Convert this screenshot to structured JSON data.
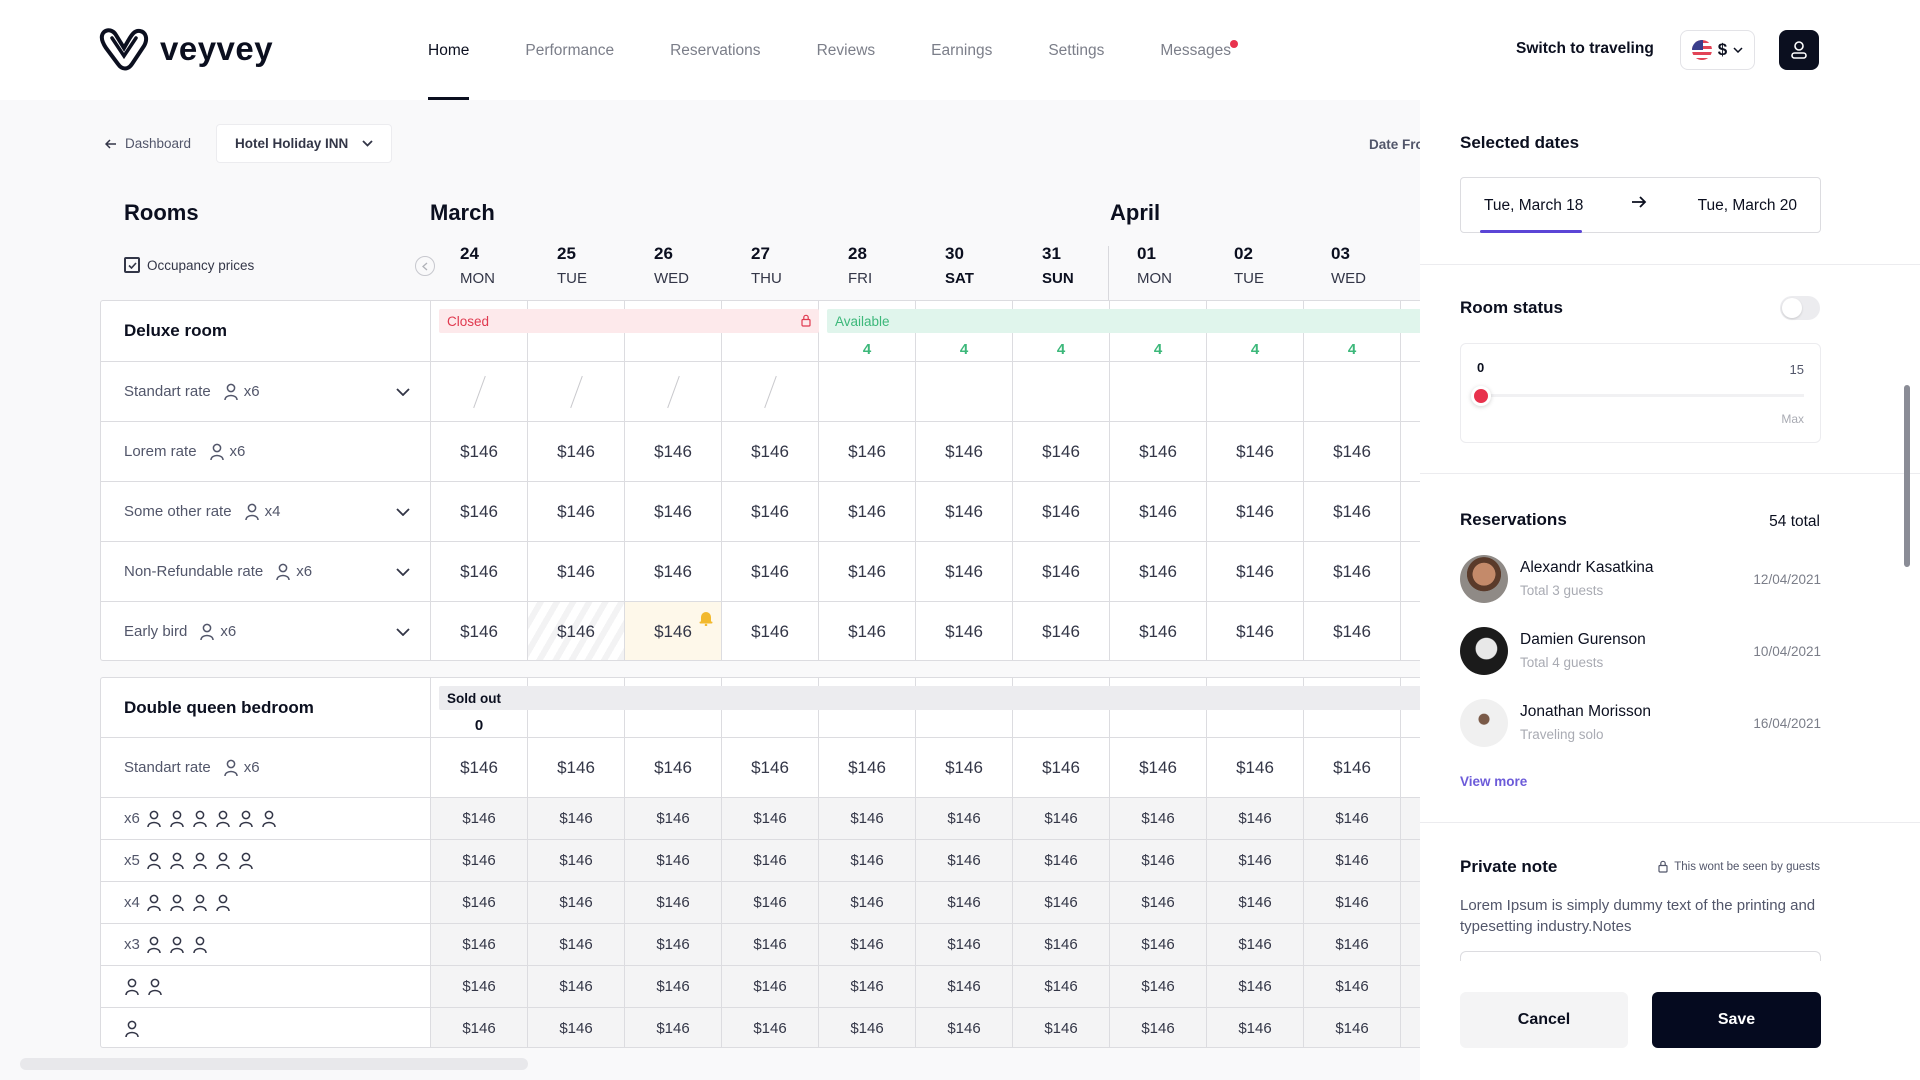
{
  "header": {
    "brand": "veyvey",
    "nav": [
      {
        "label": "Home",
        "active": true
      },
      {
        "label": "Performance",
        "active": false
      },
      {
        "label": "Reservations",
        "active": false
      },
      {
        "label": "Reviews",
        "active": false
      },
      {
        "label": "Earnings",
        "active": false
      },
      {
        "label": "Settings",
        "active": false
      },
      {
        "label": "Messages",
        "active": false,
        "notification": true
      }
    ],
    "switch_label": "Switch to traveling",
    "currency": "$",
    "flag_icon": "us-flag-icon",
    "profile_icon": "user-icon"
  },
  "subbar": {
    "back_label": "Dashboard",
    "hotel": "Hotel Holiday INN",
    "date_from_label": "Date From"
  },
  "calendar": {
    "rooms_title": "Rooms",
    "occupancy_label": "Occupancy prices",
    "occupancy_checked": true,
    "months": [
      "March",
      "April"
    ],
    "days": [
      {
        "num": "24",
        "dow": "MON",
        "weekend": false
      },
      {
        "num": "25",
        "dow": "TUE",
        "weekend": false
      },
      {
        "num": "26",
        "dow": "WED",
        "weekend": false
      },
      {
        "num": "27",
        "dow": "THU",
        "weekend": false
      },
      {
        "num": "28",
        "dow": "FRI",
        "weekend": false
      },
      {
        "num": "30",
        "dow": "SAT",
        "weekend": true
      },
      {
        "num": "31",
        "dow": "SUN",
        "weekend": true
      },
      {
        "num": "01",
        "dow": "MON",
        "weekend": false
      },
      {
        "num": "02",
        "dow": "TUE",
        "weekend": false
      },
      {
        "num": "03",
        "dow": "WED",
        "weekend": false
      }
    ]
  },
  "rooms": [
    {
      "name": "Deluxe room",
      "status_closed": "Closed",
      "status_available": "Available",
      "availability": [
        "",
        "",
        "",
        "",
        "4",
        "4",
        "4",
        "4",
        "4",
        "4"
      ],
      "rates": [
        {
          "name": "Standart rate",
          "persons": "x6",
          "expandable": true,
          "prices": [
            "/",
            "/",
            "/",
            "/",
            "",
            "",
            "",
            "",
            "",
            ""
          ]
        },
        {
          "name": "Lorem rate",
          "persons": "x6",
          "expandable": false,
          "prices": [
            "$146",
            "$146",
            "$146",
            "$146",
            "$146",
            "$146",
            "$146",
            "$146",
            "$146",
            "$146"
          ]
        },
        {
          "name": "Some other rate",
          "persons": "x4",
          "expandable": true,
          "prices": [
            "$146",
            "$146",
            "$146",
            "$146",
            "$146",
            "$146",
            "$146",
            "$146",
            "$146",
            "$146"
          ]
        },
        {
          "name": "Non-Refundable rate",
          "persons": "x6",
          "expandable": true,
          "prices": [
            "$146",
            "$146",
            "$146",
            "$146",
            "$146",
            "$146",
            "$146",
            "$146",
            "$146",
            "$146"
          ]
        },
        {
          "name": "Early bird",
          "persons": "x6",
          "expandable": true,
          "prices": [
            "$146",
            "$146",
            "$146",
            "$146",
            "$146",
            "$146",
            "$146",
            "$146",
            "$146",
            "$146"
          ]
        }
      ]
    },
    {
      "name": "Double queen bedroom",
      "status_sold": "Sold out",
      "availability": [
        "0"
      ],
      "rates": [
        {
          "name": "Standart rate",
          "persons": "x6",
          "prices": [
            "$146",
            "$146",
            "$146",
            "$146",
            "$146",
            "$146",
            "$146",
            "$146",
            "$146",
            "$146"
          ]
        }
      ],
      "occupancy": [
        {
          "label": "x6",
          "count": 6,
          "prices": [
            "$146",
            "$146",
            "$146",
            "$146",
            "$146",
            "$146",
            "$146",
            "$146",
            "$146",
            "$146"
          ]
        },
        {
          "label": "x5",
          "count": 5,
          "prices": [
            "$146",
            "$146",
            "$146",
            "$146",
            "$146",
            "$146",
            "$146",
            "$146",
            "$146",
            "$146"
          ]
        },
        {
          "label": "x4",
          "count": 4,
          "prices": [
            "$146",
            "$146",
            "$146",
            "$146",
            "$146",
            "$146",
            "$146",
            "$146",
            "$146",
            "$146"
          ]
        },
        {
          "label": "x3",
          "count": 3,
          "prices": [
            "$146",
            "$146",
            "$146",
            "$146",
            "$146",
            "$146",
            "$146",
            "$146",
            "$146",
            "$146"
          ]
        },
        {
          "label": "",
          "count": 2,
          "prices": [
            "$146",
            "$146",
            "$146",
            "$146",
            "$146",
            "$146",
            "$146",
            "$146",
            "$146",
            "$146"
          ]
        },
        {
          "label": "",
          "count": 1,
          "prices": [
            "$146",
            "$146",
            "$146",
            "$146",
            "$146",
            "$146",
            "$146",
            "$146",
            "$146",
            "$146"
          ]
        }
      ]
    }
  ],
  "panel": {
    "selected_dates_title": "Selected dates",
    "date_start": "Tue, March 18",
    "date_end": "Tue, March 20",
    "room_status_title": "Room status",
    "room_status_on": false,
    "slider": {
      "min": "0",
      "max": "15",
      "max_label": "Max",
      "value": 0
    },
    "reservations_title": "Reservations",
    "reservations_total": "54 total",
    "reservations": [
      {
        "name": "Alexandr Kasatkina",
        "sub": "Total 3 guests",
        "date": "12/04/2021"
      },
      {
        "name": "Damien Gurenson",
        "sub": "Total 4 guests",
        "date": "10/04/2021"
      },
      {
        "name": "Jonathan Morisson",
        "sub": "Traveling solo",
        "date": "16/04/2021"
      }
    ],
    "view_more": "View more",
    "private_note_title": "Private note",
    "private_note_hint": "This wont be seen by guests",
    "private_note_text": "Lorem Ipsum is simply dummy text of the printing and typesetting industry.Notes",
    "cancel_label": "Cancel",
    "save_label": "Save"
  },
  "colors": {
    "primary": "#0b0f1f",
    "accent": "#5b45d6",
    "danger": "#e8324d",
    "success": "#3cb87a",
    "warning": "#f2b92e"
  }
}
